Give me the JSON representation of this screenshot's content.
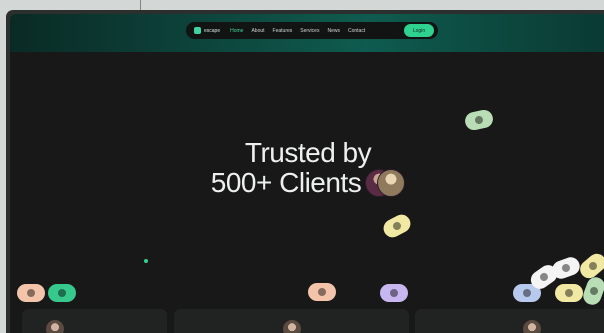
{
  "nav": {
    "logo_text": "escape",
    "links": [
      "Home",
      "About",
      "Features",
      "Services",
      "News",
      "Contact"
    ],
    "cta_label": "Login"
  },
  "hero": {
    "line1": "Trusted by",
    "line2": "500+ Clients"
  },
  "colors": {
    "accent": "#2fd38f",
    "background": "#171817",
    "pill_green": "#b9ddb4",
    "pill_yellow": "#f1e9a3",
    "pill_peach": "#f3c4a9",
    "pill_purple": "#c7b6f0",
    "pill_blue": "#b8c9ee"
  }
}
